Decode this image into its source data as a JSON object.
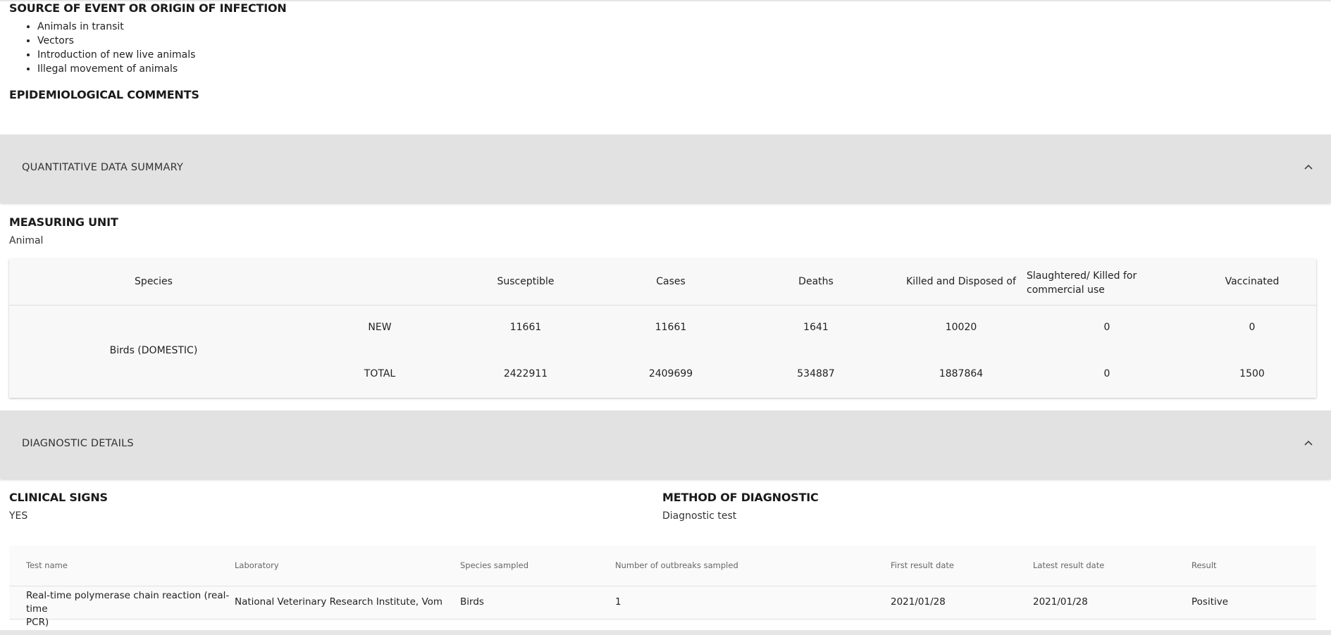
{
  "source": {
    "title": "SOURCE OF EVENT OR ORIGIN OF INFECTION",
    "items": [
      "Animals in transit",
      "Vectors",
      "Introduction of new live animals",
      "Illegal movement of animals"
    ]
  },
  "epi_comments": {
    "title": "EPIDEMIOLOGICAL COMMENTS"
  },
  "quantitative_panel": {
    "label": "QUANTITATIVE DATA SUMMARY"
  },
  "measuring_unit": {
    "title": "MEASURING UNIT",
    "value": "Animal"
  },
  "quant_table": {
    "headers": {
      "species": "Species",
      "susceptible": "Susceptible",
      "cases": "Cases",
      "deaths": "Deaths",
      "killed": "Killed and Disposed of",
      "slaughtered_line1": "Slaughtered/ Killed for",
      "slaughtered_line2": "commercial use",
      "vaccinated": "Vaccinated"
    },
    "species": "Birds (DOMESTIC)",
    "rows": [
      {
        "label": "NEW",
        "susceptible": "11661",
        "cases": "11661",
        "deaths": "1641",
        "killed": "10020",
        "slaughtered": "0",
        "vaccinated": "0"
      },
      {
        "label": "TOTAL",
        "susceptible": "2422911",
        "cases": "2409699",
        "deaths": "534887",
        "killed": "1887864",
        "slaughtered": "0",
        "vaccinated": "1500"
      }
    ]
  },
  "diagnostic_panel": {
    "label": "DIAGNOSTIC DETAILS"
  },
  "clinical_signs": {
    "title": "CLINICAL SIGNS",
    "value": "YES"
  },
  "method": {
    "title": "METHOD OF DIAGNOSTIC",
    "value": "Diagnostic test"
  },
  "diag_table": {
    "headers": {
      "test_name": "Test name",
      "laboratory": "Laboratory",
      "species_sampled": "Species sampled",
      "outbreaks": "Number of outbreaks sampled",
      "first_date": "First result date",
      "latest_date": "Latest result date",
      "result": "Result"
    },
    "rows": [
      {
        "test_name_line1": "Real-time polymerase chain reaction (real-time",
        "test_name_line2": "PCR)",
        "laboratory": "National Veterinary Research Institute, Vom",
        "species_sampled": "Birds",
        "outbreaks": "1",
        "first_date": "2021/01/28",
        "latest_date": "2021/01/28",
        "result": "Positive"
      }
    ]
  },
  "icons": {
    "panel_toggle": "chevron-up-icon"
  },
  "colors": {
    "panel_bg": "#e2e2e2",
    "table_bg": "#f8f8f8",
    "text": "#222222"
  }
}
